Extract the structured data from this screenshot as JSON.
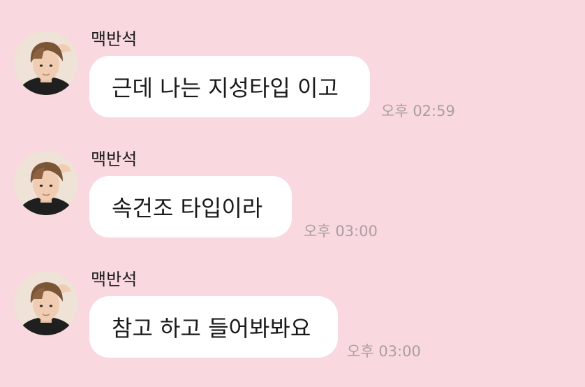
{
  "chat": {
    "messages": [
      {
        "sender": "맥반석",
        "text": "근데 나는 지성타입 이고",
        "time": "오후 02:59"
      },
      {
        "sender": "맥반석",
        "text": "속건조 타입이라",
        "time": "오후 03:00"
      },
      {
        "sender": "맥반석",
        "text": "참고 하고 들어봐봐요",
        "time": "오후 03:00"
      }
    ]
  },
  "colors": {
    "background": "#f9d9df",
    "bubble": "#ffffff",
    "timestamp": "#a99ea1"
  },
  "icons": {
    "avatar": "profile-photo"
  }
}
